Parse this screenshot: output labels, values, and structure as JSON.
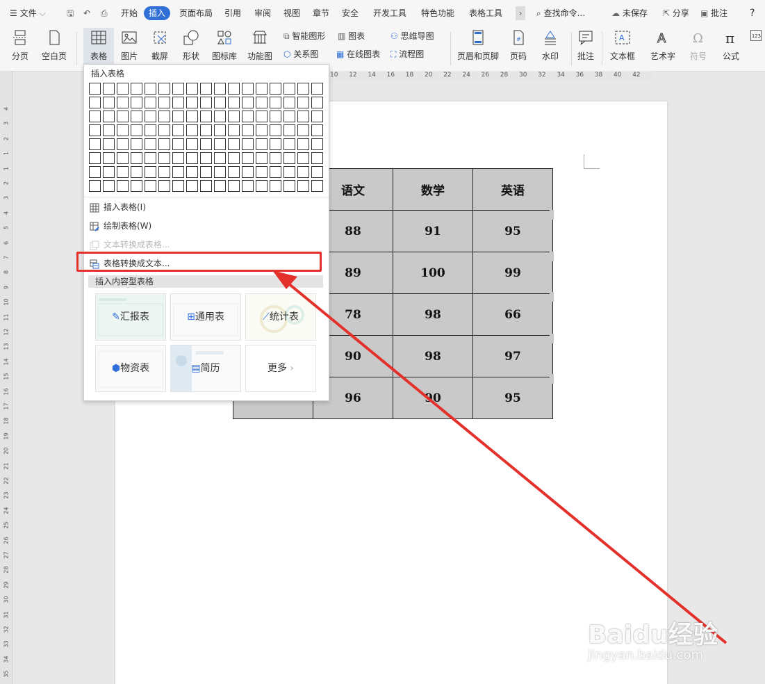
{
  "menubar": {
    "file": "文件",
    "tabs": [
      "开始",
      "插入",
      "页面布局",
      "引用",
      "审阅",
      "视图",
      "章节",
      "安全",
      "开发工具",
      "特色功能",
      "表格工具"
    ],
    "active_tab": "插入",
    "search": "查找命令...",
    "unsaved": "未保存",
    "share": "分享",
    "comment": "批注",
    "help": "?"
  },
  "ribbon": {
    "page_break": "分页",
    "blank_page": "空白页",
    "table": "表格",
    "picture": "图片",
    "screenshot": "截屏",
    "shape": "形状",
    "icon_lib": "图标库",
    "function_chart": "功能图",
    "smart_art": "智能图形",
    "chart": "图表",
    "mind_map": "思维导图",
    "relation": "关系图",
    "online_chart": "在线图表",
    "flowchart": "流程图",
    "header_footer": "页眉和页脚",
    "page_number": "页码",
    "watermark": "水印",
    "comment": "批注",
    "textbox": "文本框",
    "wordart": "艺术字",
    "symbol": "符号",
    "formula": "公式"
  },
  "ruler": {
    "top": [
      "10",
      "12",
      "14",
      "16",
      "18",
      "20",
      "22",
      "24",
      "26",
      "28",
      "30",
      "32",
      "34",
      "36",
      "38",
      "40",
      "42"
    ],
    "left": [
      "4",
      "3",
      "2",
      "1",
      "1",
      "2",
      "3",
      "4",
      "5",
      "6",
      "7",
      "8",
      "9",
      "10",
      "11",
      "12",
      "13",
      "14",
      "15",
      "16",
      "17",
      "18",
      "19",
      "20",
      "21",
      "22",
      "23",
      "24",
      "25",
      "26",
      "27",
      "28",
      "29",
      "30",
      "31",
      "32",
      "33",
      "34",
      "35"
    ]
  },
  "dropdown": {
    "title": "插入表格",
    "items": [
      {
        "label": "插入表格(I)",
        "enabled": true
      },
      {
        "label": "绘制表格(W)",
        "enabled": true
      },
      {
        "label": "文本转换成表格...",
        "enabled": false
      },
      {
        "label": "表格转换成文本...",
        "enabled": true
      }
    ],
    "section": "插入内容型表格",
    "templates": [
      "汇报表",
      "通用表",
      "统计表",
      "物资表",
      "简历",
      "更多"
    ]
  },
  "doc_table": {
    "header": [
      "语文",
      "数学",
      "英语"
    ],
    "rows": [
      [
        "88",
        "91",
        "95"
      ],
      [
        "89",
        "100",
        "99"
      ],
      [
        "78",
        "98",
        "66"
      ],
      [
        "90",
        "98",
        "97"
      ],
      [
        "96",
        "90",
        "95"
      ]
    ]
  },
  "watermark": {
    "brand": "Baidu经验",
    "url": "jingyan.baidu.com"
  },
  "colors": {
    "accent": "#2f6fd6",
    "highlight": "#e4302b",
    "table_fill": "#c9c9c9"
  }
}
